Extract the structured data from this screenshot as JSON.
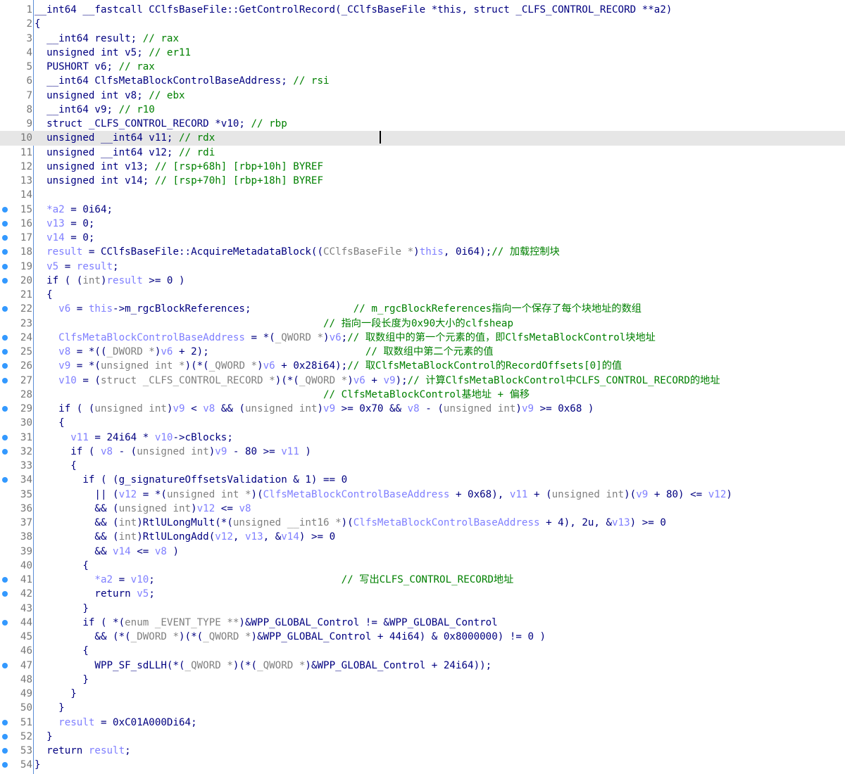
{
  "editor": {
    "current_line": 10,
    "lines": [
      {
        "n": "1",
        "bp": false,
        "tokens": [
          [
            "id",
            "__int64 __fastcall CClfsBaseFile::GetControlRecord(_CClfsBaseFile *this, struct _CLFS_CONTROL_RECORD **a2)"
          ]
        ]
      },
      {
        "n": "2",
        "bp": false,
        "tokens": [
          [
            "op",
            "{"
          ]
        ]
      },
      {
        "n": "3",
        "bp": false,
        "tokens": [
          [
            "id",
            "  __int64 result; "
          ],
          [
            "cm",
            "// rax"
          ]
        ]
      },
      {
        "n": "4",
        "bp": false,
        "tokens": [
          [
            "id",
            "  unsigned int v5; "
          ],
          [
            "cm",
            "// er11"
          ]
        ]
      },
      {
        "n": "5",
        "bp": false,
        "tokens": [
          [
            "id",
            "  PUSHORT v6; "
          ],
          [
            "cm",
            "// rax"
          ]
        ]
      },
      {
        "n": "6",
        "bp": false,
        "tokens": [
          [
            "id",
            "  __int64 ClfsMetaBlockControlBaseAddress; "
          ],
          [
            "cm",
            "// rsi"
          ]
        ]
      },
      {
        "n": "7",
        "bp": false,
        "tokens": [
          [
            "id",
            "  unsigned int v8; "
          ],
          [
            "cm",
            "// ebx"
          ]
        ]
      },
      {
        "n": "8",
        "bp": false,
        "tokens": [
          [
            "id",
            "  __int64 v9; "
          ],
          [
            "cm",
            "// r10"
          ]
        ]
      },
      {
        "n": "9",
        "bp": false,
        "tokens": [
          [
            "id",
            "  struct _CLFS_CONTROL_RECORD *v10; "
          ],
          [
            "cm",
            "// rbp"
          ]
        ]
      },
      {
        "n": "10",
        "bp": false,
        "tokens": [
          [
            "id",
            "  unsigned __int64 v11; "
          ],
          [
            "cm",
            "// rdx"
          ]
        ]
      },
      {
        "n": "11",
        "bp": false,
        "tokens": [
          [
            "id",
            "  unsigned __int64 v12; "
          ],
          [
            "cm",
            "// rdi"
          ]
        ]
      },
      {
        "n": "12",
        "bp": false,
        "tokens": [
          [
            "id",
            "  unsigned int v13; "
          ],
          [
            "cm",
            "// [rsp+68h] [rbp+10h] BYREF"
          ]
        ]
      },
      {
        "n": "13",
        "bp": false,
        "tokens": [
          [
            "id",
            "  unsigned int v14; "
          ],
          [
            "cm",
            "// [rsp+70h] [rbp+18h] BYREF"
          ]
        ]
      },
      {
        "n": "14",
        "bp": false,
        "tokens": [
          [
            "id",
            ""
          ]
        ]
      },
      {
        "n": "15",
        "bp": true,
        "tokens": [
          [
            "var",
            "  *a2"
          ],
          [
            "op",
            " = 0i64;"
          ]
        ]
      },
      {
        "n": "16",
        "bp": true,
        "tokens": [
          [
            "var",
            "  v13"
          ],
          [
            "op",
            " = 0;"
          ]
        ]
      },
      {
        "n": "17",
        "bp": true,
        "tokens": [
          [
            "var",
            "  v14"
          ],
          [
            "op",
            " = 0;"
          ]
        ]
      },
      {
        "n": "18",
        "bp": true,
        "tokens": [
          [
            "var",
            "  result"
          ],
          [
            "op",
            " = CClfsBaseFile::AcquireMetadataBlock(("
          ],
          [
            "ty",
            "CClfsBaseFile *"
          ],
          [
            "op",
            ")"
          ],
          [
            "var",
            "this"
          ],
          [
            "op",
            ", 0i64);"
          ],
          [
            "cm",
            "// 加载控制块"
          ]
        ]
      },
      {
        "n": "19",
        "bp": true,
        "tokens": [
          [
            "var",
            "  v5"
          ],
          [
            "op",
            " = "
          ],
          [
            "var",
            "result"
          ],
          [
            "op",
            ";"
          ]
        ]
      },
      {
        "n": "20",
        "bp": true,
        "tokens": [
          [
            "op",
            "  if ( ("
          ],
          [
            "ty",
            "int"
          ],
          [
            "op",
            ")"
          ],
          [
            "var",
            "result"
          ],
          [
            "op",
            " >= 0 )"
          ]
        ]
      },
      {
        "n": "21",
        "bp": false,
        "tokens": [
          [
            "op",
            "  {"
          ]
        ]
      },
      {
        "n": "22",
        "bp": true,
        "tokens": [
          [
            "var",
            "    v6"
          ],
          [
            "op",
            " = "
          ],
          [
            "var",
            "this"
          ],
          [
            "op",
            "->m_rgcBlockReferences;                 "
          ],
          [
            "cm",
            "// m_rgcBlockReferences指向一个保存了每个块地址的数组"
          ]
        ]
      },
      {
        "n": "23",
        "bp": false,
        "tokens": [
          [
            "op",
            "                                                "
          ],
          [
            "cm",
            "// 指向一段长度为0x90大小的clfsheap"
          ]
        ]
      },
      {
        "n": "24",
        "bp": true,
        "tokens": [
          [
            "var",
            "    ClfsMetaBlockControlBaseAddress"
          ],
          [
            "op",
            " = *("
          ],
          [
            "ty",
            "_QWORD *"
          ],
          [
            "op",
            ")"
          ],
          [
            "var",
            "v6"
          ],
          [
            "op",
            ";"
          ],
          [
            "cm",
            "// 取数组中的第一个元素的值，即ClfsMetaBlockControl块地址"
          ]
        ]
      },
      {
        "n": "25",
        "bp": true,
        "tokens": [
          [
            "var",
            "    v8"
          ],
          [
            "op",
            " = *(("
          ],
          [
            "ty",
            "_DWORD *"
          ],
          [
            "op",
            ")"
          ],
          [
            "var",
            "v6"
          ],
          [
            "op",
            " + 2);                          "
          ],
          [
            "cm",
            "// 取数组中第二个元素的值"
          ]
        ]
      },
      {
        "n": "26",
        "bp": true,
        "tokens": [
          [
            "var",
            "    v9"
          ],
          [
            "op",
            " = *("
          ],
          [
            "ty",
            "unsigned int *"
          ],
          [
            "op",
            ")(*("
          ],
          [
            "ty",
            "_QWORD *"
          ],
          [
            "op",
            ")"
          ],
          [
            "var",
            "v6"
          ],
          [
            "op",
            " + 0x28i64);"
          ],
          [
            "cm",
            "// 取ClfsMetaBlockControl的RecordOffsets[0]的值"
          ]
        ]
      },
      {
        "n": "27",
        "bp": true,
        "tokens": [
          [
            "var",
            "    v10"
          ],
          [
            "op",
            " = ("
          ],
          [
            "ty",
            "struct _CLFS_CONTROL_RECORD *"
          ],
          [
            "op",
            ")(*("
          ],
          [
            "ty",
            "_QWORD *"
          ],
          [
            "op",
            ")"
          ],
          [
            "var",
            "v6"
          ],
          [
            "op",
            " + "
          ],
          [
            "var",
            "v9"
          ],
          [
            "op",
            ");"
          ],
          [
            "cm",
            "// 计算ClfsMetaBlockControl中CLFS_CONTROL_RECORD的地址"
          ]
        ]
      },
      {
        "n": "28",
        "bp": false,
        "tokens": [
          [
            "op",
            "                                                "
          ],
          [
            "cm",
            "// ClfsMetaBlockControl基地址 + 偏移"
          ]
        ]
      },
      {
        "n": "29",
        "bp": true,
        "tokens": [
          [
            "op",
            "    if ( ("
          ],
          [
            "ty",
            "unsigned int"
          ],
          [
            "op",
            ")"
          ],
          [
            "var",
            "v9"
          ],
          [
            "op",
            " < "
          ],
          [
            "var",
            "v8"
          ],
          [
            "op",
            " && ("
          ],
          [
            "ty",
            "unsigned int"
          ],
          [
            "op",
            ")"
          ],
          [
            "var",
            "v9"
          ],
          [
            "op",
            " >= 0x70 && "
          ],
          [
            "var",
            "v8"
          ],
          [
            "op",
            " - ("
          ],
          [
            "ty",
            "unsigned int"
          ],
          [
            "op",
            ")"
          ],
          [
            "var",
            "v9"
          ],
          [
            "op",
            " >= 0x68 )"
          ]
        ]
      },
      {
        "n": "30",
        "bp": false,
        "tokens": [
          [
            "op",
            "    {"
          ]
        ]
      },
      {
        "n": "31",
        "bp": true,
        "tokens": [
          [
            "var",
            "      v11"
          ],
          [
            "op",
            " = 24i64 * "
          ],
          [
            "var",
            "v10"
          ],
          [
            "op",
            "->cBlocks;"
          ]
        ]
      },
      {
        "n": "32",
        "bp": true,
        "tokens": [
          [
            "op",
            "      if ( "
          ],
          [
            "var",
            "v8"
          ],
          [
            "op",
            " - ("
          ],
          [
            "ty",
            "unsigned int"
          ],
          [
            "op",
            ")"
          ],
          [
            "var",
            "v9"
          ],
          [
            "op",
            " - 80 >= "
          ],
          [
            "var",
            "v11"
          ],
          [
            "op",
            " )"
          ]
        ]
      },
      {
        "n": "33",
        "bp": false,
        "tokens": [
          [
            "op",
            "      {"
          ]
        ]
      },
      {
        "n": "34",
        "bp": true,
        "tokens": [
          [
            "op",
            "        if ( (g_signatureOffsetsValidation & 1) == 0"
          ]
        ]
      },
      {
        "n": "35",
        "bp": false,
        "tokens": [
          [
            "op",
            "          || ("
          ],
          [
            "var",
            "v12"
          ],
          [
            "op",
            " = *("
          ],
          [
            "ty",
            "unsigned int *"
          ],
          [
            "op",
            ")("
          ],
          [
            "var",
            "ClfsMetaBlockControlBaseAddress"
          ],
          [
            "op",
            " + 0x68), "
          ],
          [
            "var",
            "v11"
          ],
          [
            "op",
            " + ("
          ],
          [
            "ty",
            "unsigned int"
          ],
          [
            "op",
            ")("
          ],
          [
            "var",
            "v9"
          ],
          [
            "op",
            " + 80) <= "
          ],
          [
            "var",
            "v12"
          ],
          [
            "op",
            ")"
          ]
        ]
      },
      {
        "n": "36",
        "bp": false,
        "tokens": [
          [
            "op",
            "          && ("
          ],
          [
            "ty",
            "unsigned int"
          ],
          [
            "op",
            ")"
          ],
          [
            "var",
            "v12"
          ],
          [
            "op",
            " <= "
          ],
          [
            "var",
            "v8"
          ]
        ]
      },
      {
        "n": "37",
        "bp": false,
        "tokens": [
          [
            "op",
            "          && ("
          ],
          [
            "ty",
            "int"
          ],
          [
            "op",
            ")RtlULongMult(*("
          ],
          [
            "ty",
            "unsigned __int16 *"
          ],
          [
            "op",
            ")("
          ],
          [
            "var",
            "ClfsMetaBlockControlBaseAddress"
          ],
          [
            "op",
            " + 4), 2u, &"
          ],
          [
            "var",
            "v13"
          ],
          [
            "op",
            ") >= 0"
          ]
        ]
      },
      {
        "n": "38",
        "bp": false,
        "tokens": [
          [
            "op",
            "          && ("
          ],
          [
            "ty",
            "int"
          ],
          [
            "op",
            ")RtlULongAdd("
          ],
          [
            "var",
            "v12"
          ],
          [
            "op",
            ", "
          ],
          [
            "var",
            "v13"
          ],
          [
            "op",
            ", &"
          ],
          [
            "var",
            "v14"
          ],
          [
            "op",
            ") >= 0"
          ]
        ]
      },
      {
        "n": "39",
        "bp": false,
        "tokens": [
          [
            "op",
            "          && "
          ],
          [
            "var",
            "v14"
          ],
          [
            "op",
            " <= "
          ],
          [
            "var",
            "v8"
          ],
          [
            "op",
            " )"
          ]
        ]
      },
      {
        "n": "40",
        "bp": false,
        "tokens": [
          [
            "op",
            "        {"
          ]
        ]
      },
      {
        "n": "41",
        "bp": true,
        "tokens": [
          [
            "var",
            "          *a2"
          ],
          [
            "op",
            " = "
          ],
          [
            "var",
            "v10"
          ],
          [
            "op",
            ";                               "
          ],
          [
            "cm",
            "// 写出CLFS_CONTROL_RECORD地址"
          ]
        ]
      },
      {
        "n": "42",
        "bp": true,
        "tokens": [
          [
            "op",
            "          return "
          ],
          [
            "var",
            "v5"
          ],
          [
            "op",
            ";"
          ]
        ]
      },
      {
        "n": "43",
        "bp": false,
        "tokens": [
          [
            "op",
            "        }"
          ]
        ]
      },
      {
        "n": "44",
        "bp": true,
        "tokens": [
          [
            "op",
            "        if ( *("
          ],
          [
            "ty",
            "enum _EVENT_TYPE **"
          ],
          [
            "op",
            ")&WPP_GLOBAL_Control != &WPP_GLOBAL_Control"
          ]
        ]
      },
      {
        "n": "45",
        "bp": false,
        "tokens": [
          [
            "op",
            "          && (*("
          ],
          [
            "ty",
            "_DWORD *"
          ],
          [
            "op",
            ")(*("
          ],
          [
            "ty",
            "_QWORD *"
          ],
          [
            "op",
            ")&WPP_GLOBAL_Control + 44i64) & 0x8000000) != 0 )"
          ]
        ]
      },
      {
        "n": "46",
        "bp": false,
        "tokens": [
          [
            "op",
            "        {"
          ]
        ]
      },
      {
        "n": "47",
        "bp": true,
        "tokens": [
          [
            "op",
            "          WPP_SF_sdLLH(*("
          ],
          [
            "ty",
            "_QWORD *"
          ],
          [
            "op",
            ")(*("
          ],
          [
            "ty",
            "_QWORD *"
          ],
          [
            "op",
            ")&WPP_GLOBAL_Control + 24i64));"
          ]
        ]
      },
      {
        "n": "48",
        "bp": false,
        "tokens": [
          [
            "op",
            "        }"
          ]
        ]
      },
      {
        "n": "49",
        "bp": false,
        "tokens": [
          [
            "op",
            "      }"
          ]
        ]
      },
      {
        "n": "50",
        "bp": false,
        "tokens": [
          [
            "op",
            "    }"
          ]
        ]
      },
      {
        "n": "51",
        "bp": true,
        "tokens": [
          [
            "var",
            "    result"
          ],
          [
            "op",
            " = 0xC01A000Di64;"
          ]
        ]
      },
      {
        "n": "52",
        "bp": true,
        "tokens": [
          [
            "op",
            "  }"
          ]
        ]
      },
      {
        "n": "53",
        "bp": true,
        "tokens": [
          [
            "op",
            "  return "
          ],
          [
            "var",
            "result"
          ],
          [
            "op",
            ";"
          ]
        ]
      },
      {
        "n": "54",
        "bp": true,
        "tokens": [
          [
            "op",
            "}"
          ]
        ]
      }
    ]
  }
}
